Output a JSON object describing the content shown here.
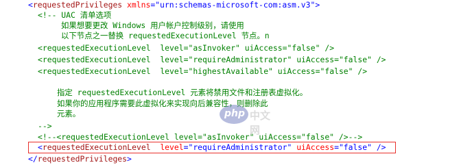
{
  "colors": {
    "tag": "#a31515",
    "attribute": "#ff0000",
    "value": "#0000ff",
    "comment": "#008000",
    "highlight_border": "#e8302b"
  },
  "code": {
    "line1": {
      "open": "<",
      "tag": "requestedPrivileges",
      "attr": "xmlns",
      "eq": "=",
      "value": "\"urn:schemas-microsoft-com:asm.v3\"",
      "close": ">"
    },
    "comment_open": "<!-- UAC 清单选项",
    "comment_line2": "如果想要更改 Windows 用户帐户控制级别，请使用",
    "comment_line3": "以下节点之一替换 requestedExecutionLevel 节点。n",
    "level_line1": {
      "open": "<",
      "tag": "requestedExecutionLevel",
      "attr1": "level",
      "val1": "\"asInvoker\"",
      "attr2": "uiAccess",
      "val2": "\"false\"",
      "close": "/>"
    },
    "level_line2": {
      "open": "<",
      "tag": "requestedExecutionLevel",
      "attr1": "level",
      "val1": "\"requireAdministrator\"",
      "attr2": "uiAccess",
      "val2": "\"false\"",
      "close": "/>"
    },
    "level_line3": {
      "open": "<",
      "tag": "requestedExecutionLevel",
      "attr1": "level",
      "val1": "\"highestAvailable\"",
      "attr2": "uiAccess",
      "val2": "\"false\"",
      "close": "/>"
    },
    "comment_line7": "指定 requestedExecutionLevel 元素将禁用文件和注册表虚拟化。",
    "comment_line8": "如果你的应用程序需要此虚拟化来实现向后兼容性，则删除此",
    "comment_line9": "元素。",
    "comment_close": "-->",
    "commented_line": "<!--<requestedExecutionLevel level=\"asInvoker\" uiAccess=\"false\" />-->",
    "highlighted_line": {
      "open": "<",
      "tag": "requestedExecutionLevel",
      "attr1": "level",
      "val1": "\"requireAdministrator\"",
      "attr2": "uiAccess",
      "val2": "\"false\"",
      "close": "/>"
    },
    "closing_line": {
      "open": "</",
      "tag": "requestedPrivileges",
      "close": ">"
    }
  },
  "watermark": {
    "logo_text": "php",
    "site_text": "中文网"
  }
}
